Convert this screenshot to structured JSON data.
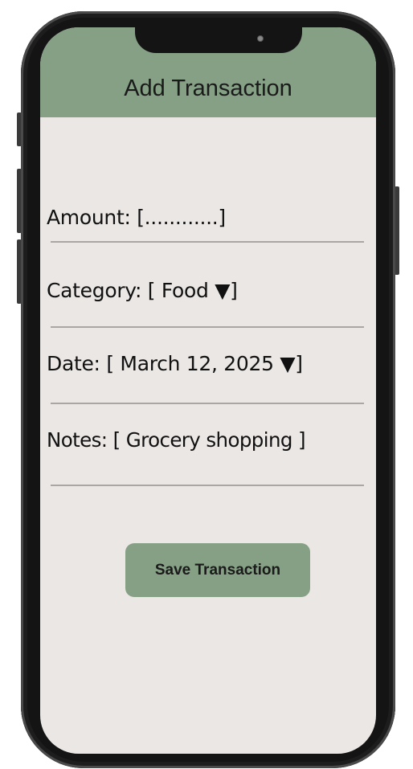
{
  "header": {
    "title": "Add Transaction"
  },
  "form": {
    "amount_label": "Amount: [............]",
    "category_label": "Category: [ Food ▼]",
    "date_label": "Date: [ March 12, 2025 ▼]",
    "notes_label": "Notes: [ Grocery shopping ]"
  },
  "actions": {
    "save_label": "Save Transaction"
  },
  "colors": {
    "accent": "#86a085",
    "screen_background": "#ebe7e5",
    "divider": "#a9a6a4",
    "frame": "#141414"
  }
}
